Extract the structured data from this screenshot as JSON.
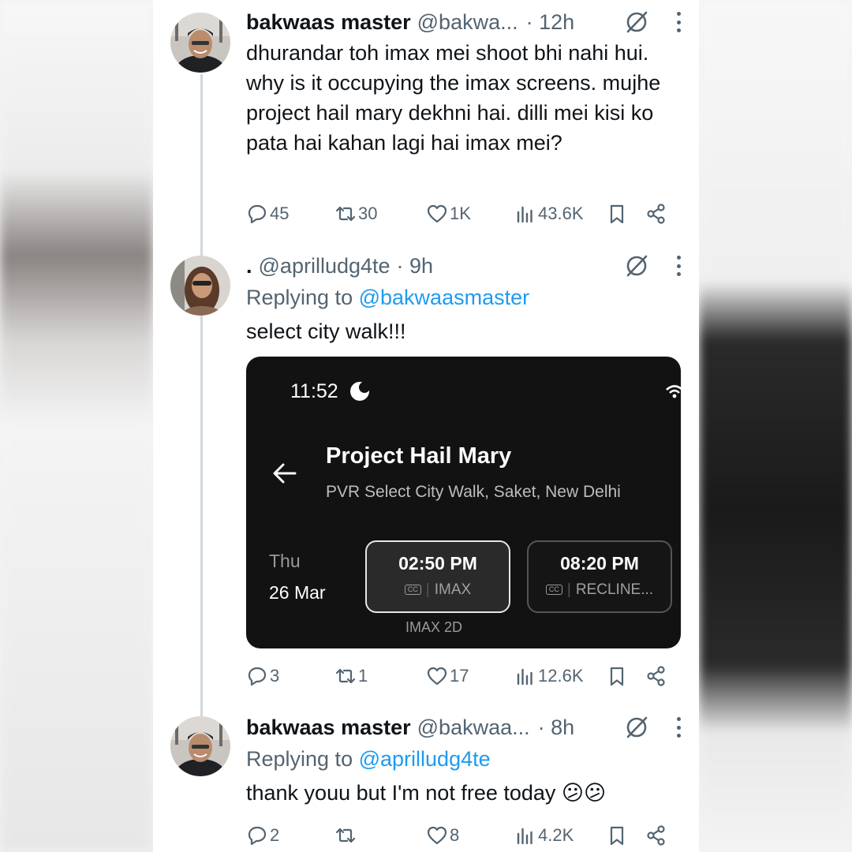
{
  "tweets": [
    {
      "name": "bakwaas master",
      "handle": "@bakwa...",
      "time": "· 12h",
      "text": "dhurandar toh imax mei shoot bhi nahi hui. why is it occupying the imax screens. mujhe project hail mary dekhni hai. dilli mei kisi ko pata hai kahan lagi hai imax mei?",
      "replies": "45",
      "reposts": "30",
      "likes": "1K",
      "views": "43.6K"
    },
    {
      "name": ".",
      "handle": "@aprilludg4te",
      "time": "· 9h",
      "reply_prefix": "Replying to",
      "reply_to": "@bakwaasmaster",
      "text": "select city walk!!!",
      "replies": "3",
      "reposts": "1",
      "likes": "17",
      "views": "12.6K"
    },
    {
      "name": "bakwaas master",
      "handle": "@bakwaa...",
      "time": "· 8h",
      "reply_prefix": "Replying to",
      "reply_to": "@aprilludg4te",
      "text": "thank youu but I'm not free today 😕😕",
      "replies": "2",
      "reposts": "",
      "likes": "8",
      "views": "4.2K"
    }
  ],
  "embedded_screenshot": {
    "status_time": "11:52",
    "movie_title": "Project Hail Mary",
    "venue": "PVR Select City Walk, Saket, New Delhi",
    "day": "Thu",
    "date": "26 Mar",
    "cc_label": "CC",
    "slots": [
      {
        "time": "02:50 PM",
        "format": "IMAX",
        "selected": true
      },
      {
        "time": "08:20 PM",
        "format": "RECLINE..."
      }
    ],
    "slot_note": "IMAX 2D"
  },
  "icons": {
    "grok": "grok-icon",
    "more": "more-icon",
    "reply": "reply-icon",
    "repost": "repost-icon",
    "like": "heart-icon",
    "views": "views-icon",
    "bookmark": "bookmark-icon",
    "share": "share-icon"
  },
  "colors": {
    "text": "#0f1419",
    "secondary": "#536471",
    "link": "#1d9bf0",
    "card_bg": "#121212"
  }
}
